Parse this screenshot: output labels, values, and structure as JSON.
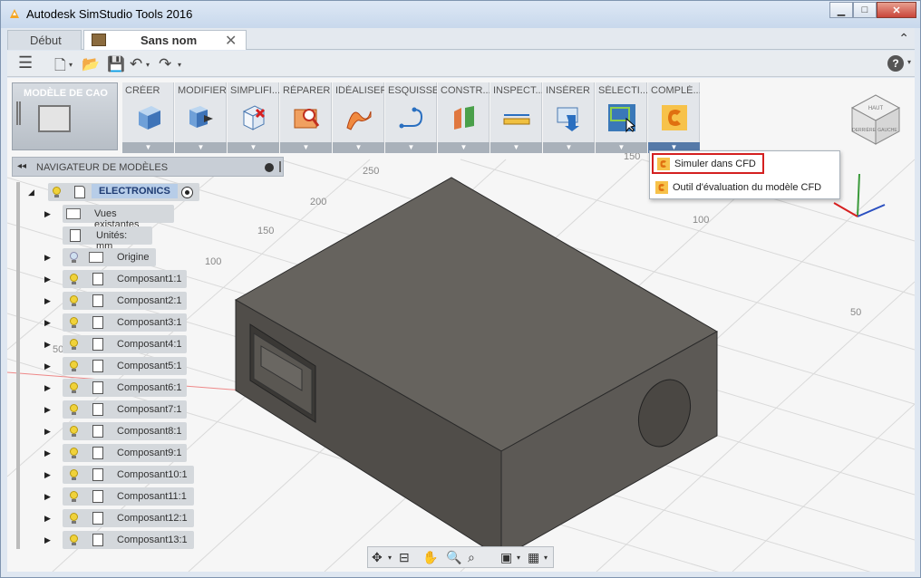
{
  "window": {
    "title": "Autodesk SimStudio Tools 2016"
  },
  "tabs": [
    {
      "label": "Début"
    },
    {
      "label": "Sans nom"
    }
  ],
  "ribbon": {
    "workspace": "MODÈLE DE CAO",
    "groups": [
      {
        "label": "CRÉER",
        "icon": "box-icon"
      },
      {
        "label": "MODIFIER",
        "icon": "modify-icon"
      },
      {
        "label": "SIMPLIFI...",
        "icon": "simplify-icon"
      },
      {
        "label": "RÉPARER",
        "icon": "repair-icon"
      },
      {
        "label": "IDÉALISER",
        "icon": "idealize-icon"
      },
      {
        "label": "ESQUISSE",
        "icon": "sketch-icon"
      },
      {
        "label": "CONSTR...",
        "icon": "construct-icon"
      },
      {
        "label": "INSPECT...",
        "icon": "inspect-icon"
      },
      {
        "label": "INSÉRER",
        "icon": "insert-icon"
      },
      {
        "label": "SÉLECTI...",
        "icon": "select-icon"
      },
      {
        "label": "COMPLÉ...",
        "icon": "addin-icon"
      }
    ]
  },
  "dropdown": {
    "items": [
      {
        "label": "Simuler dans CFD"
      },
      {
        "label": "Outil d'évaluation du modèle CFD"
      }
    ]
  },
  "navigator": {
    "title": "NAVIGATEUR DE MODÈLES",
    "root": "ELECTRONICS",
    "rows": [
      {
        "label": "Vues existantes"
      },
      {
        "label": "Unités: mm"
      },
      {
        "label": "Origine"
      },
      {
        "label": "Composant1:1"
      },
      {
        "label": "Composant2:1"
      },
      {
        "label": "Composant3:1"
      },
      {
        "label": "Composant4:1"
      },
      {
        "label": "Composant5:1"
      },
      {
        "label": "Composant6:1"
      },
      {
        "label": "Composant7:1"
      },
      {
        "label": "Composant8:1"
      },
      {
        "label": "Composant9:1"
      },
      {
        "label": "Composant10:1"
      },
      {
        "label": "Composant11:1"
      },
      {
        "label": "Composant12:1"
      },
      {
        "label": "Composant13:1"
      }
    ]
  },
  "grid_labels": [
    "250",
    "200",
    "150",
    "100",
    "50",
    "150",
    "100",
    "50"
  ],
  "viewcube": {
    "faces": [
      "HAUT",
      "DERRIÈRE",
      "GAUCHE"
    ]
  },
  "colors": {
    "accent": "#5579a8",
    "highlight": "#d42020",
    "model": "#5f5c57"
  }
}
